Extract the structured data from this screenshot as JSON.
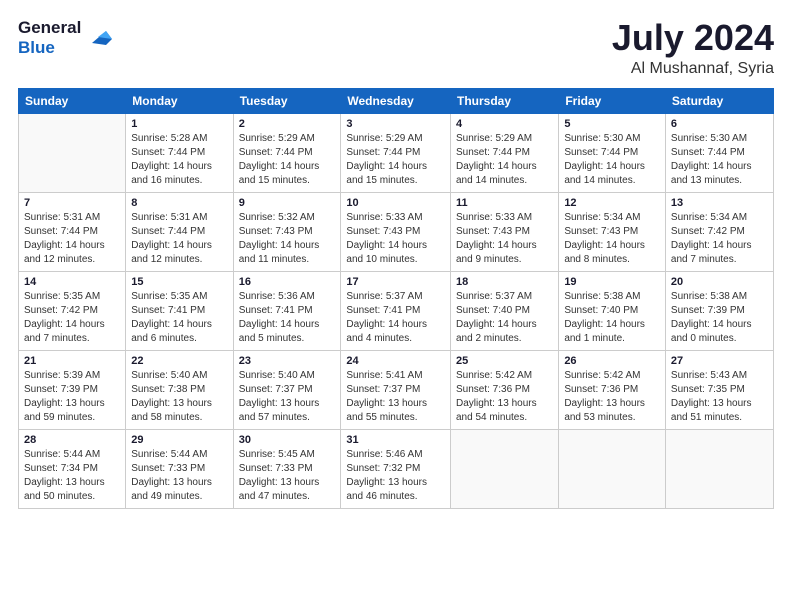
{
  "header": {
    "logo_line1": "General",
    "logo_line2": "Blue",
    "month": "July 2024",
    "location": "Al Mushannaf, Syria"
  },
  "weekdays": [
    "Sunday",
    "Monday",
    "Tuesday",
    "Wednesday",
    "Thursday",
    "Friday",
    "Saturday"
  ],
  "weeks": [
    [
      {
        "day": "",
        "info": ""
      },
      {
        "day": "1",
        "info": "Sunrise: 5:28 AM\nSunset: 7:44 PM\nDaylight: 14 hours\nand 16 minutes."
      },
      {
        "day": "2",
        "info": "Sunrise: 5:29 AM\nSunset: 7:44 PM\nDaylight: 14 hours\nand 15 minutes."
      },
      {
        "day": "3",
        "info": "Sunrise: 5:29 AM\nSunset: 7:44 PM\nDaylight: 14 hours\nand 15 minutes."
      },
      {
        "day": "4",
        "info": "Sunrise: 5:29 AM\nSunset: 7:44 PM\nDaylight: 14 hours\nand 14 minutes."
      },
      {
        "day": "5",
        "info": "Sunrise: 5:30 AM\nSunset: 7:44 PM\nDaylight: 14 hours\nand 14 minutes."
      },
      {
        "day": "6",
        "info": "Sunrise: 5:30 AM\nSunset: 7:44 PM\nDaylight: 14 hours\nand 13 minutes."
      }
    ],
    [
      {
        "day": "7",
        "info": "Sunrise: 5:31 AM\nSunset: 7:44 PM\nDaylight: 14 hours\nand 12 minutes."
      },
      {
        "day": "8",
        "info": "Sunrise: 5:31 AM\nSunset: 7:44 PM\nDaylight: 14 hours\nand 12 minutes."
      },
      {
        "day": "9",
        "info": "Sunrise: 5:32 AM\nSunset: 7:43 PM\nDaylight: 14 hours\nand 11 minutes."
      },
      {
        "day": "10",
        "info": "Sunrise: 5:33 AM\nSunset: 7:43 PM\nDaylight: 14 hours\nand 10 minutes."
      },
      {
        "day": "11",
        "info": "Sunrise: 5:33 AM\nSunset: 7:43 PM\nDaylight: 14 hours\nand 9 minutes."
      },
      {
        "day": "12",
        "info": "Sunrise: 5:34 AM\nSunset: 7:43 PM\nDaylight: 14 hours\nand 8 minutes."
      },
      {
        "day": "13",
        "info": "Sunrise: 5:34 AM\nSunset: 7:42 PM\nDaylight: 14 hours\nand 7 minutes."
      }
    ],
    [
      {
        "day": "14",
        "info": "Sunrise: 5:35 AM\nSunset: 7:42 PM\nDaylight: 14 hours\nand 7 minutes."
      },
      {
        "day": "15",
        "info": "Sunrise: 5:35 AM\nSunset: 7:41 PM\nDaylight: 14 hours\nand 6 minutes."
      },
      {
        "day": "16",
        "info": "Sunrise: 5:36 AM\nSunset: 7:41 PM\nDaylight: 14 hours\nand 5 minutes."
      },
      {
        "day": "17",
        "info": "Sunrise: 5:37 AM\nSunset: 7:41 PM\nDaylight: 14 hours\nand 4 minutes."
      },
      {
        "day": "18",
        "info": "Sunrise: 5:37 AM\nSunset: 7:40 PM\nDaylight: 14 hours\nand 2 minutes."
      },
      {
        "day": "19",
        "info": "Sunrise: 5:38 AM\nSunset: 7:40 PM\nDaylight: 14 hours\nand 1 minute."
      },
      {
        "day": "20",
        "info": "Sunrise: 5:38 AM\nSunset: 7:39 PM\nDaylight: 14 hours\nand 0 minutes."
      }
    ],
    [
      {
        "day": "21",
        "info": "Sunrise: 5:39 AM\nSunset: 7:39 PM\nDaylight: 13 hours\nand 59 minutes."
      },
      {
        "day": "22",
        "info": "Sunrise: 5:40 AM\nSunset: 7:38 PM\nDaylight: 13 hours\nand 58 minutes."
      },
      {
        "day": "23",
        "info": "Sunrise: 5:40 AM\nSunset: 7:37 PM\nDaylight: 13 hours\nand 57 minutes."
      },
      {
        "day": "24",
        "info": "Sunrise: 5:41 AM\nSunset: 7:37 PM\nDaylight: 13 hours\nand 55 minutes."
      },
      {
        "day": "25",
        "info": "Sunrise: 5:42 AM\nSunset: 7:36 PM\nDaylight: 13 hours\nand 54 minutes."
      },
      {
        "day": "26",
        "info": "Sunrise: 5:42 AM\nSunset: 7:36 PM\nDaylight: 13 hours\nand 53 minutes."
      },
      {
        "day": "27",
        "info": "Sunrise: 5:43 AM\nSunset: 7:35 PM\nDaylight: 13 hours\nand 51 minutes."
      }
    ],
    [
      {
        "day": "28",
        "info": "Sunrise: 5:44 AM\nSunset: 7:34 PM\nDaylight: 13 hours\nand 50 minutes."
      },
      {
        "day": "29",
        "info": "Sunrise: 5:44 AM\nSunset: 7:33 PM\nDaylight: 13 hours\nand 49 minutes."
      },
      {
        "day": "30",
        "info": "Sunrise: 5:45 AM\nSunset: 7:33 PM\nDaylight: 13 hours\nand 47 minutes."
      },
      {
        "day": "31",
        "info": "Sunrise: 5:46 AM\nSunset: 7:32 PM\nDaylight: 13 hours\nand 46 minutes."
      },
      {
        "day": "",
        "info": ""
      },
      {
        "day": "",
        "info": ""
      },
      {
        "day": "",
        "info": ""
      }
    ]
  ]
}
